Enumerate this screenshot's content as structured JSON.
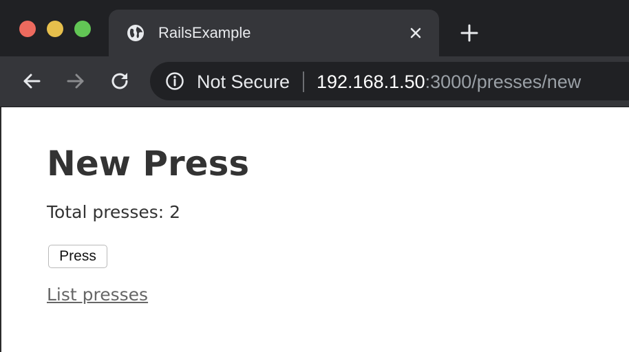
{
  "browser": {
    "tab": {
      "title": "RailsExample",
      "icon": "globe-icon"
    },
    "window_controls": {
      "close_color": "#ed6a5e",
      "minimize_color": "#e6bf4c",
      "maximize_color": "#62c655"
    },
    "address_bar": {
      "security_label": "Not Secure",
      "url_host": "192.168.1.50",
      "url_rest": ":3000/presses/new"
    },
    "icons": {
      "back": "arrow-left-icon",
      "forward": "arrow-right-icon",
      "reload": "reload-icon",
      "info": "info-circle-icon",
      "close_tab": "close-icon",
      "new_tab": "plus-icon"
    }
  },
  "page": {
    "title": "New Press",
    "total_text": "Total presses: 2",
    "press_button_label": "Press",
    "list_link_label": "List presses"
  },
  "colors": {
    "chrome_dark": "#202124",
    "chrome_mid": "#35363a",
    "text_dark": "#333333",
    "link_gray": "#666666"
  }
}
